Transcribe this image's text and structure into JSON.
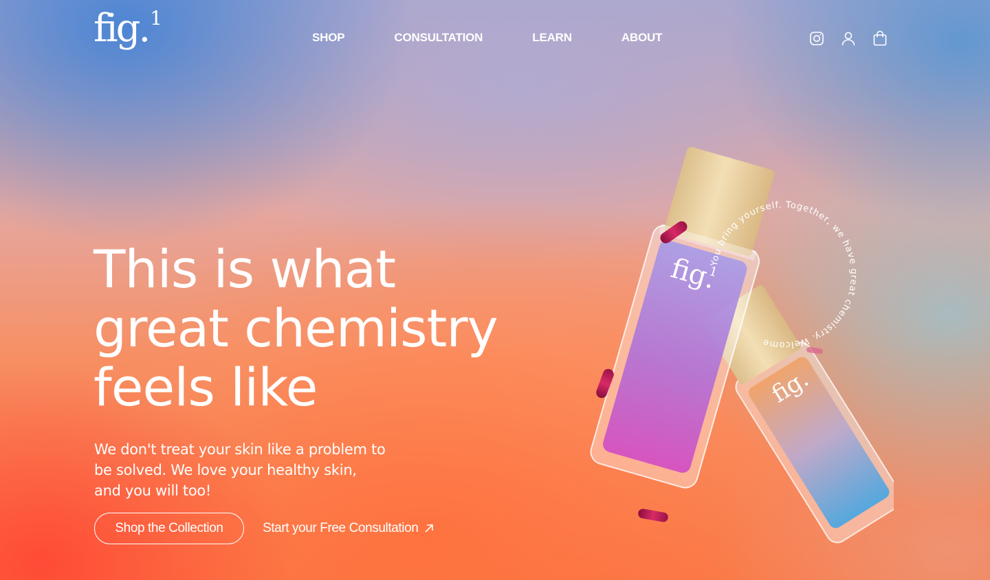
{
  "brand": {
    "logo_text": "fig.",
    "logo_sup": "1"
  },
  "nav": {
    "items": [
      {
        "label": "SHOP"
      },
      {
        "label": "CONSULTATION"
      },
      {
        "label": "LEARN"
      },
      {
        "label": "ABOUT"
      }
    ]
  },
  "header_icons": [
    "instagram-icon",
    "user-icon",
    "shopping-bag-icon"
  ],
  "hero": {
    "headline_lines": [
      "This is what",
      "great chemistry",
      "feels like"
    ],
    "subcopy_lines": [
      "We don't treat your skin like a problem to",
      "be solved. We love your healthy skin,",
      "and you will too!"
    ],
    "cta_primary": "Shop the Collection",
    "cta_secondary": "Start your Free Consultation"
  },
  "product": {
    "bottle_logo": "fig.",
    "bottle_logo_sup": "1",
    "circle_text": "You bring yourself. Together, we have great chemistry. Welcome"
  },
  "colors": {
    "text": "#ffffff",
    "cap": "#efd7a6",
    "capsule": "#c21a55"
  }
}
